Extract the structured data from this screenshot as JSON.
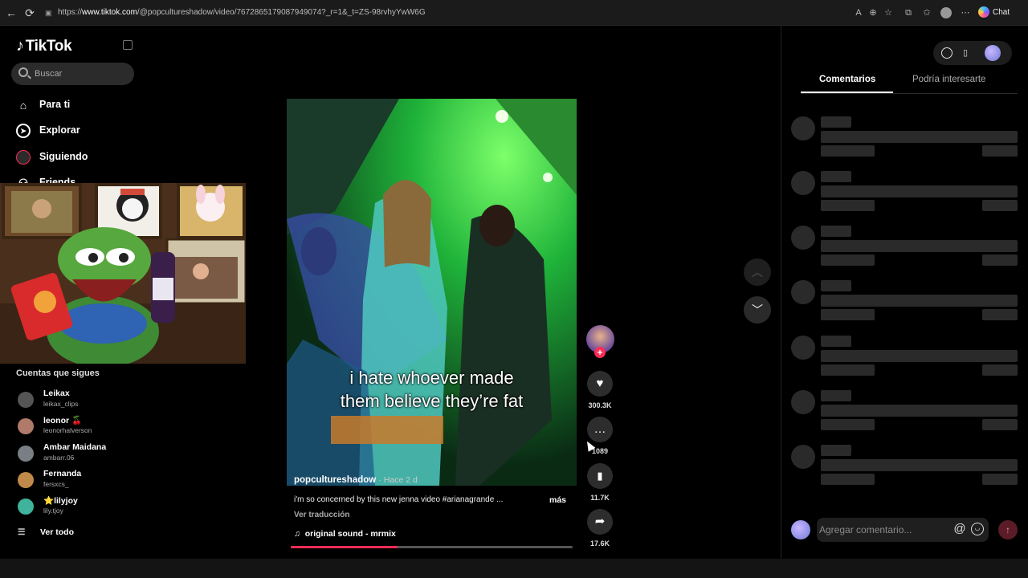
{
  "browser": {
    "url_prefix": "https://",
    "url_host": "www.tiktok.com",
    "url_path": "/@popcultureshadow/video/7672865179087949074?_r=1&_t=ZS-98rvhyYwW6G",
    "chat_label": "Chat"
  },
  "sidebar": {
    "brand": "TikTok",
    "search_placeholder": "Buscar",
    "nav": [
      {
        "label": "Para ti",
        "icon": "home-icon"
      },
      {
        "label": "Explorar",
        "icon": "compass-icon"
      },
      {
        "label": "Siguiendo",
        "icon": "following-icon"
      },
      {
        "label": "Friends",
        "icon": "friends-icon"
      }
    ],
    "following_title": "Cuentas que sigues",
    "accounts": [
      {
        "name": "Leikax",
        "handle": "leikax_clips",
        "color": "#555555"
      },
      {
        "name": "leonor 🍒",
        "handle": "leonorhalverson",
        "color": "#b07a6a"
      },
      {
        "name": "Ambar Maidana",
        "handle": "ambarr.06",
        "color": "#7a7f86"
      },
      {
        "name": "Fernanda",
        "handle": "fersxcs_",
        "color": "#c08a4a"
      },
      {
        "name": "⭐lilyjoy",
        "handle": "lily.tjoy",
        "color": "#3fb39b"
      }
    ],
    "see_all": "Ver todo"
  },
  "video": {
    "caption_line1": "i hate whoever made",
    "caption_line2": "them believe they’re fat",
    "author": "popcultureshadow",
    "posted": "· Hace 2 d",
    "description": "i'm so concerned by this new jenna video #arianagrande ...",
    "more": "más",
    "translate": "Ver traducción",
    "sound": "original sound - mrmix",
    "progress": 0.38
  },
  "actions": {
    "likes": "300.3K",
    "comments": "1089",
    "saves": "11.7K",
    "shares": "17.6K"
  },
  "panel": {
    "tab_comments": "Comentarios",
    "tab_suggested": "Podría interesarte",
    "comment_placeholder": "Agregar comentario...",
    "at_symbol": "@"
  },
  "colors": {
    "accent": "#fe2c55"
  }
}
